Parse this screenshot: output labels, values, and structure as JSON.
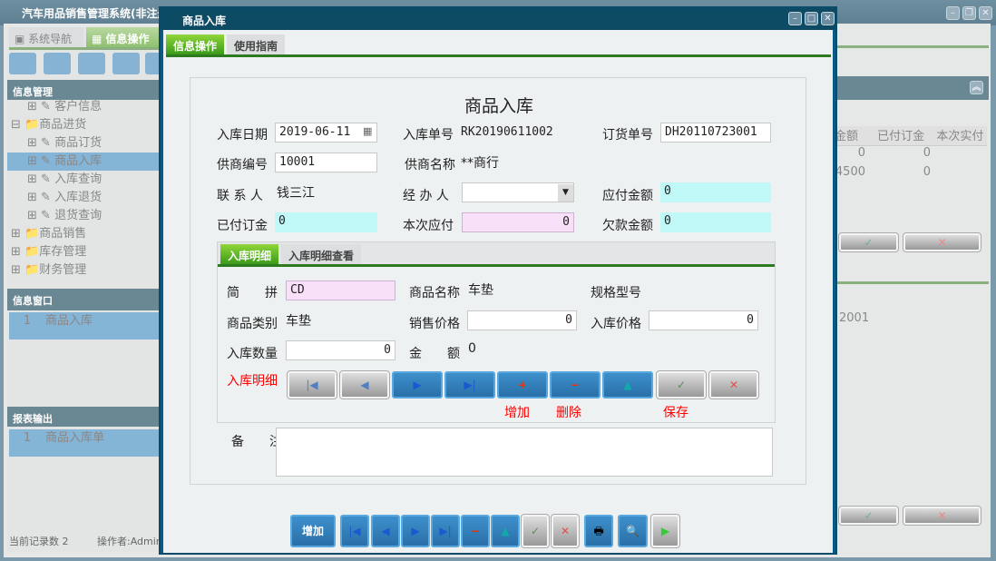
{
  "app": {
    "title": "汽车用品销售管理系统(非注册",
    "nav_tabs": [
      "系统导航",
      "信息操作"
    ],
    "section_info": "信息管理",
    "tree": [
      {
        "label": "客户信息",
        "level": 2
      },
      {
        "label": "商品进货",
        "level": 1,
        "expanded": true
      },
      {
        "label": "商品订货",
        "level": 2
      },
      {
        "label": "商品入库",
        "level": 2,
        "selected": true
      },
      {
        "label": "入库查询",
        "level": 2
      },
      {
        "label": "入库退货",
        "level": 2
      },
      {
        "label": "退货查询",
        "level": 2
      },
      {
        "label": "商品销售",
        "level": 1
      },
      {
        "label": "库存管理",
        "level": 1
      },
      {
        "label": "财务管理",
        "level": 1
      }
    ],
    "section_window": "信息窗口",
    "windows": [
      {
        "no": "1",
        "label": "商品入库"
      }
    ],
    "section_report": "报表输出",
    "reports": [
      {
        "no": "1",
        "label": "商品入库单"
      }
    ],
    "status_count": "当前记录数 2",
    "status_operator": "操作者:Admin",
    "bg_grid": {
      "headers": [
        "金额",
        "已付订金",
        "本次实付"
      ],
      "rows": [
        [
          "0",
          "0",
          ""
        ],
        [
          "4500",
          "0",
          ""
        ]
      ]
    },
    "bg_grid2_cell": "2001"
  },
  "dialog": {
    "title": "商品入库",
    "tabs": [
      "信息操作",
      "使用指南"
    ],
    "form_title": "商品入库",
    "labels": {
      "date": "入库日期",
      "rk_no": "入库单号",
      "order_no": "订货单号",
      "supplier_no": "供商编号",
      "supplier_name": "供商名称",
      "contact": "联 系 人",
      "handler": "经 办 人",
      "payable": "应付金额",
      "deposit": "已付订金",
      "this_pay": "本次应付",
      "owed": "欠款金额"
    },
    "values": {
      "date": "2019-06-11",
      "rk_no": "RK20190611002",
      "order_no": "DH20110723001",
      "supplier_no": "10001",
      "supplier_name": "**商行",
      "contact": "钱三江",
      "handler": "",
      "payable": "0",
      "deposit": "0",
      "this_pay": "0",
      "owed": "0"
    },
    "detail_tabs": [
      "入库明细",
      "入库明细查看"
    ],
    "detail_labels": {
      "pinyin": "简　　拼",
      "name": "商品名称",
      "spec": "规格型号",
      "category": "商品类别",
      "sale_price": "销售价格",
      "in_price": "入库价格",
      "qty": "入库数量",
      "amount": "金　　额",
      "detail_caption": "入库明细",
      "add": "增加",
      "delete": "删除",
      "save": "保存",
      "remark": "备　　注"
    },
    "detail_values": {
      "pinyin": "CD",
      "name": "车垫",
      "spec": "",
      "category": "车垫",
      "sale_price": "0",
      "in_price": "0",
      "qty": "0",
      "amount": "0",
      "remark": ""
    },
    "bottom_add": "增加"
  }
}
